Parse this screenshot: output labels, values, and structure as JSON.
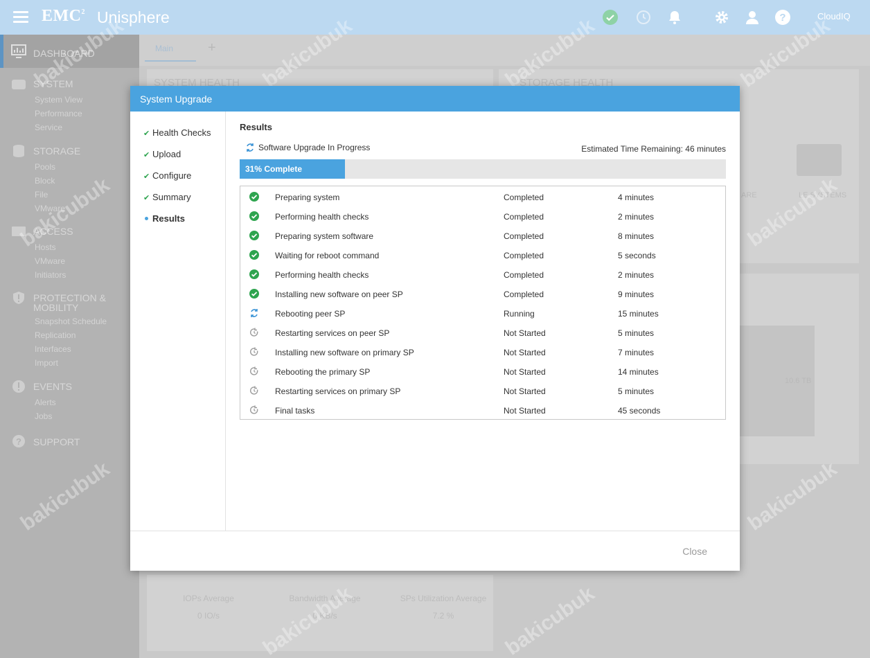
{
  "topbar": {
    "brand": "EMC",
    "brand_sup": "2",
    "app_name": "Unisphere",
    "cloudiq": "CloudIQ",
    "icons": [
      "menu-icon",
      "health-check-icon",
      "jobs-icon",
      "alerts-bell-icon",
      "settings-gear-icon",
      "user-icon",
      "help-icon"
    ]
  },
  "sidebar": {
    "dashboard": "DASHBOARD",
    "sections": [
      {
        "title": "SYSTEM",
        "items": [
          "System View",
          "Performance",
          "Service"
        ]
      },
      {
        "title": "STORAGE",
        "items": [
          "Pools",
          "Block",
          "File",
          "VMware"
        ]
      },
      {
        "title": "ACCESS",
        "items": [
          "Hosts",
          "VMware",
          "Initiators"
        ]
      },
      {
        "title": "PROTECTION &",
        "title2": "MOBILITY",
        "items": [
          "Snapshot Schedule",
          "Replication",
          "Interfaces",
          "Import"
        ]
      },
      {
        "title": "EVENTS",
        "items": [
          "Alerts",
          "Jobs"
        ]
      },
      {
        "title": "SUPPORT",
        "items": []
      }
    ]
  },
  "background": {
    "tab_main": "Main",
    "tab_add": "+",
    "system_health": "SYSTEM HEALTH",
    "storage_health": "STORAGE HEALTH",
    "bg_label_a": "ARE",
    "bg_label_b": "LE SYSTEMS",
    "capacity_value": "10.6 TB",
    "stats": [
      {
        "label": "IOPs Average",
        "value": "0 IO/s"
      },
      {
        "label": "Bandwidth Average",
        "value": "0 KB/s"
      },
      {
        "label": "SPs Utilization Average",
        "value": "7.2 %"
      }
    ],
    "watermark": "bakicubuk"
  },
  "dialog": {
    "title": "System Upgrade",
    "steps": [
      {
        "label": "Health Checks",
        "state": "done"
      },
      {
        "label": "Upload",
        "state": "done"
      },
      {
        "label": "Configure",
        "state": "done"
      },
      {
        "label": "Summary",
        "state": "done"
      },
      {
        "label": "Results",
        "state": "active"
      }
    ],
    "results_title": "Results",
    "status_text": "Software Upgrade In Progress",
    "eta_text": "Estimated Time Remaining: 46 minutes",
    "progress": {
      "percent": 31,
      "label": "31% Complete"
    },
    "tasks": [
      {
        "name": "Preparing system",
        "status": "Completed",
        "duration": "4 minutes",
        "state": "done"
      },
      {
        "name": "Performing health checks",
        "status": "Completed",
        "duration": "2 minutes",
        "state": "done"
      },
      {
        "name": "Preparing system software",
        "status": "Completed",
        "duration": "8 minutes",
        "state": "done"
      },
      {
        "name": "Waiting for reboot command",
        "status": "Completed",
        "duration": "5 seconds",
        "state": "done"
      },
      {
        "name": "Performing health checks",
        "status": "Completed",
        "duration": "2 minutes",
        "state": "done"
      },
      {
        "name": "Installing new software on peer SP",
        "status": "Completed",
        "duration": "9 minutes",
        "state": "done"
      },
      {
        "name": "Rebooting peer SP",
        "status": "Running",
        "duration": "15 minutes",
        "state": "running"
      },
      {
        "name": "Restarting services on peer SP",
        "status": "Not Started",
        "duration": "5 minutes",
        "state": "pending"
      },
      {
        "name": "Installing new software on primary SP",
        "status": "Not Started",
        "duration": "7 minutes",
        "state": "pending"
      },
      {
        "name": "Rebooting the primary SP",
        "status": "Not Started",
        "duration": "14 minutes",
        "state": "pending"
      },
      {
        "name": "Restarting services on primary SP",
        "status": "Not Started",
        "duration": "5 minutes",
        "state": "pending"
      },
      {
        "name": "Final tasks",
        "status": "Not Started",
        "duration": "45 seconds",
        "state": "pending"
      }
    ],
    "close_label": "Close"
  },
  "colors": {
    "accent": "#4aa3df",
    "success": "#2ea44f",
    "pending": "#9a9a9a"
  }
}
